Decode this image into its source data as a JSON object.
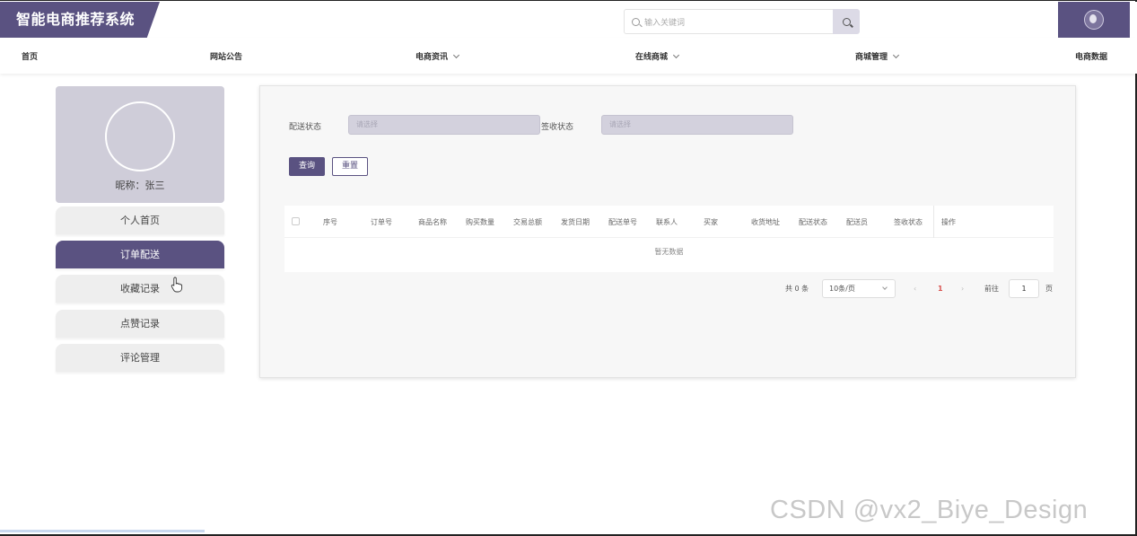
{
  "header": {
    "logo_text": "智能电商推荐系统",
    "search_placeholder": "输入关键词"
  },
  "nav": {
    "items": [
      {
        "label": "首页",
        "has_dropdown": false
      },
      {
        "label": "网站公告",
        "has_dropdown": false
      },
      {
        "label": "电商资讯",
        "has_dropdown": true
      },
      {
        "label": "在线商城",
        "has_dropdown": true
      },
      {
        "label": "商城管理",
        "has_dropdown": true
      },
      {
        "label": "电商数据",
        "has_dropdown": false
      }
    ]
  },
  "sidebar": {
    "nickname": "昵称：张三",
    "items": [
      {
        "label": "个人首页",
        "active": false
      },
      {
        "label": "订单配送",
        "active": true
      },
      {
        "label": "收藏记录",
        "active": false
      },
      {
        "label": "点赞记录",
        "active": false
      },
      {
        "label": "评论管理",
        "active": false
      }
    ]
  },
  "filters": {
    "delivery_status_label": "配送状态",
    "delivery_status_placeholder": "请选择",
    "sign_status_label": "签收状态",
    "sign_status_placeholder": "请选择",
    "query_button": "查询",
    "reset_button": "重置"
  },
  "table": {
    "columns": [
      "序号",
      "订单号",
      "商品名称",
      "购买数量",
      "交易总额",
      "发货日期",
      "配送单号",
      "联系人",
      "买家",
      "收货地址",
      "配送状态",
      "配送员",
      "签收状态",
      "操作"
    ],
    "empty_text": "暂无数据"
  },
  "pagination": {
    "total_text": "共 0 条",
    "page_size": "10条/页",
    "current_page": "1",
    "goto_label": "前往",
    "goto_value": "1",
    "page_suffix": "页"
  },
  "watermark": "CSDN @vx2_Biye_Design",
  "colors": {
    "primary": "#5a5281",
    "profile_bg": "#cfcdd9",
    "active_page": "#d9534f"
  }
}
